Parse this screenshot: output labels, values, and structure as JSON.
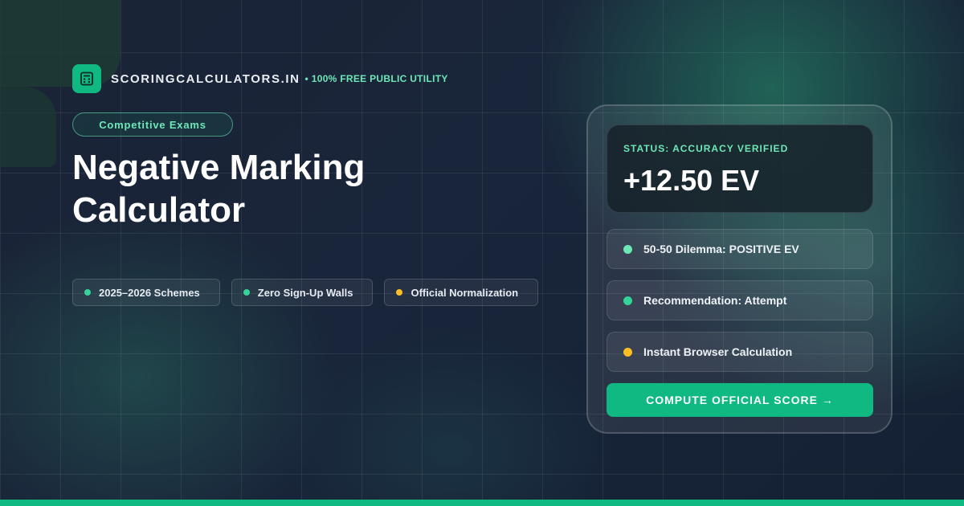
{
  "brand": {
    "name": "SCORINGCALCULATORS.IN",
    "separator": "•",
    "tagline": "100% FREE PUBLIC UTILITY",
    "logo_icon": "calculator-icon"
  },
  "category": "Competitive Exams",
  "title_line1": "Negative Marking",
  "title_line2": "Calculator",
  "features": [
    {
      "label": "2025–2026 Schemes",
      "dot_color": "#34d399"
    },
    {
      "label": "Zero Sign-Up Walls",
      "dot_color": "#34d399"
    },
    {
      "label": "Official Normalization",
      "dot_color": "#fbbf24"
    }
  ],
  "card": {
    "status_label": "STATUS: ACCURACY VERIFIED",
    "status_value": "+12.50 EV",
    "rows": [
      {
        "label": "50-50 Dilemma: POSITIVE EV",
        "dot_color": "#6ee7b7"
      },
      {
        "label": "Recommendation: Attempt",
        "dot_color": "#34d399"
      },
      {
        "label": "Instant Browser Calculation",
        "dot_color": "#fbbf24"
      }
    ],
    "cta_label": "COMPUTE OFFICIAL SCORE →"
  },
  "colors": {
    "accent": "#10b981",
    "accent_light": "#6ee7b7",
    "warning": "#fbbf24",
    "background": "#162233"
  }
}
